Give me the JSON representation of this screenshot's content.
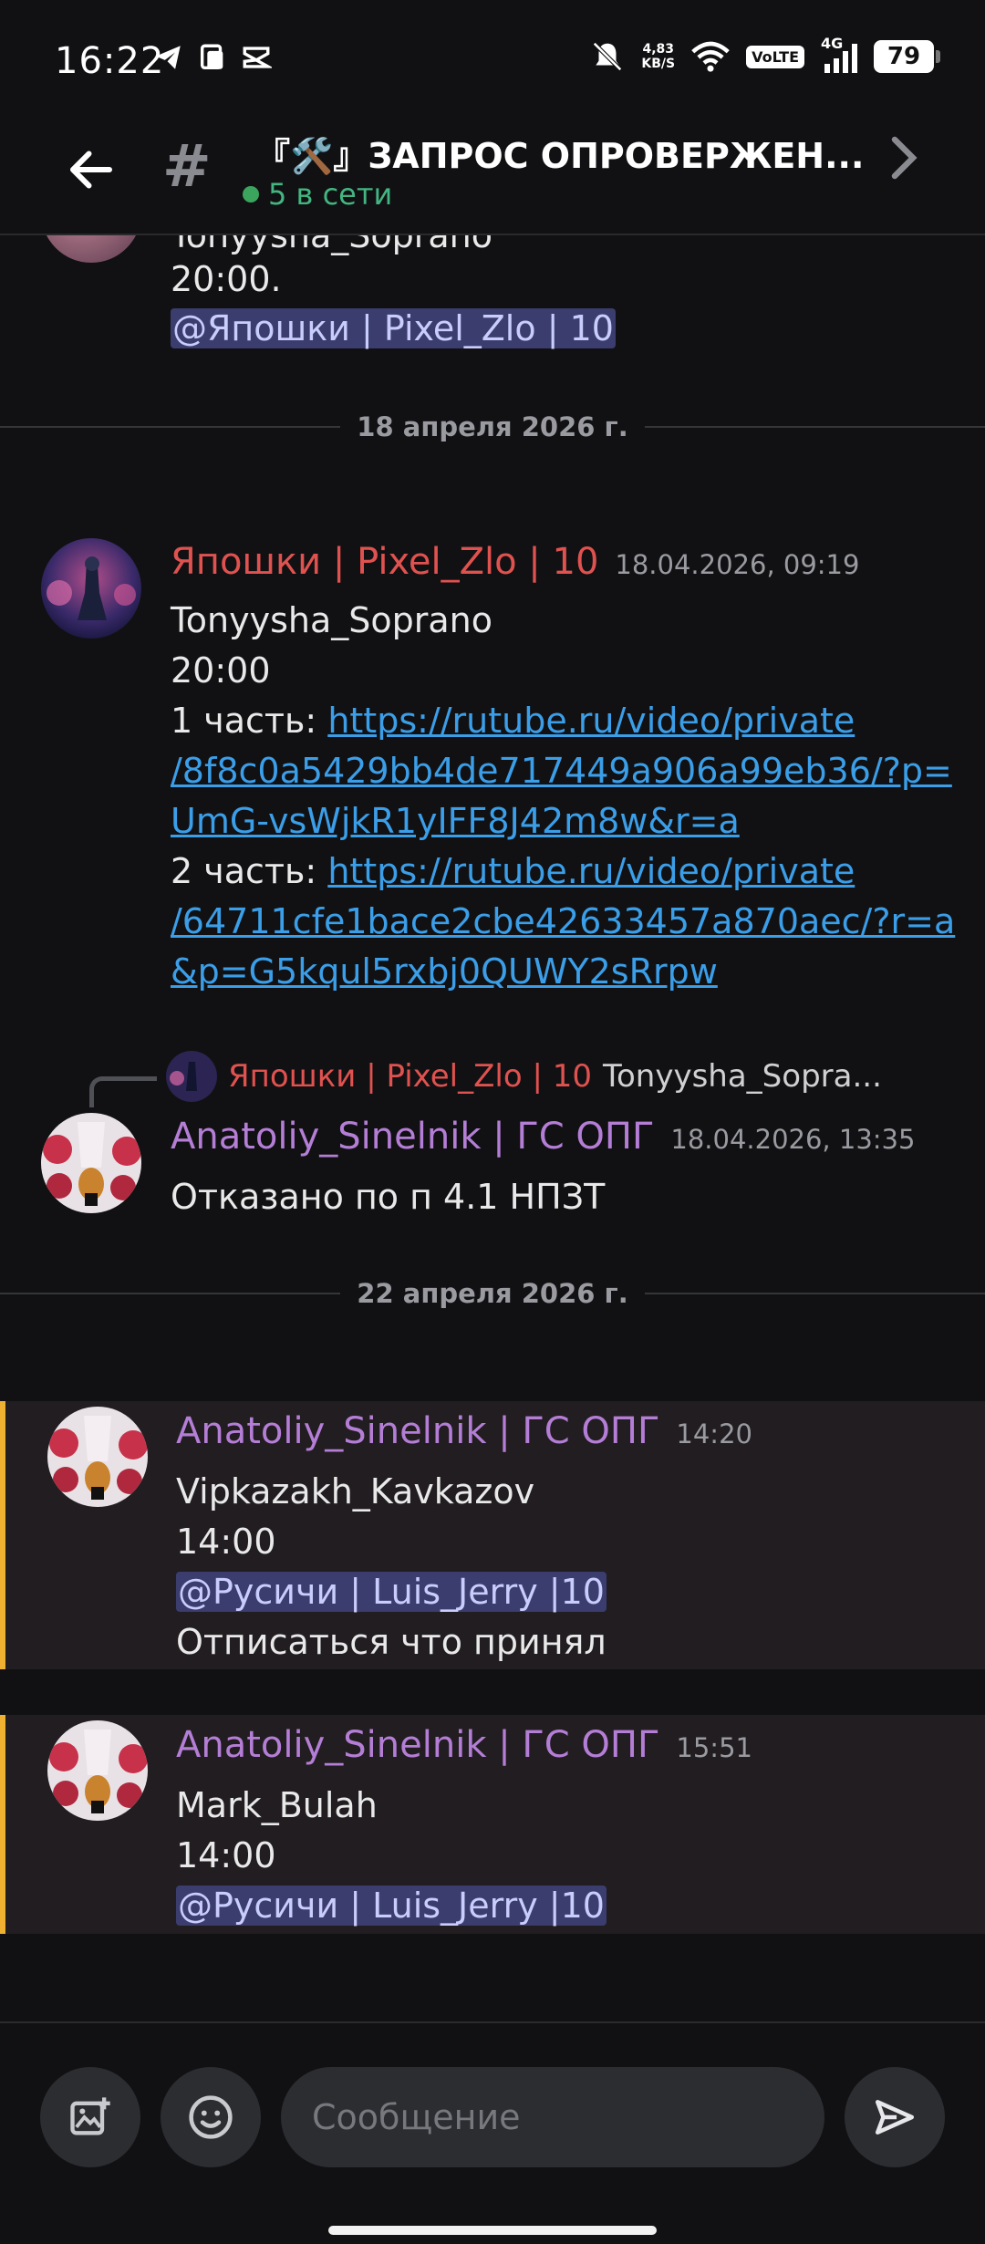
{
  "status_bar": {
    "time": "16:22",
    "net_speed_value": "4,83",
    "net_speed_unit": "KB/S",
    "volte": "VoLTE",
    "network": "4G",
    "battery": "79"
  },
  "header": {
    "channel_title": "『🛠️』ЗАПРОС ОПРОВЕРЖЕН...",
    "online": "5 в сети"
  },
  "messages": {
    "top_partial": {
      "author_line_cut": "Tonyysha_Soprano",
      "time_text": "20:00.",
      "mention": "@Япошки | Pixel_Zlo | 10"
    },
    "sep1": "18 апреля 2026 г.",
    "m1": {
      "author": "Япошки | Pixel_Zlo | 10",
      "timestamp": "18.04.2026, 09:19",
      "line1": "Tonyysha_Soprano",
      "line2": "20:00",
      "part1_label": "1 часть: ",
      "part1_link_a": "https://rutube.ru/video/private",
      "part1_link_b": "/8f8c0a5429bb4de717449a906a99eb36/?p=",
      "part1_link_c": "UmG-vsWjkR1yIFF8J42m8w&r=a",
      "part2_label": "2 часть: ",
      "part2_link_a": "https://rutube.ru/video/private",
      "part2_link_b": "/64711cfe1bace2cbe42633457a870aec/?r=a",
      "part2_link_c": "&p=G5kqul5rxbj0QUWY2sRrpw"
    },
    "m2": {
      "reply_author": "Япошки | Pixel_Zlo | 10",
      "reply_text": "Tonyysha_Sopra...",
      "author": "Anatoliy_Sinelnik | ГС ОПГ",
      "timestamp": "18.04.2026, 13:35",
      "line1": "Отказано по п 4.1 НПЗТ"
    },
    "sep2": "22 апреля 2026 г.",
    "m3": {
      "author": "Anatoliy_Sinelnik | ГС ОПГ",
      "timestamp": "14:20",
      "line1": "Vipkazakh_Kavkazov",
      "line2": "14:00",
      "mention": "@Русичи | Luis_Jerry |10",
      "line4": "Отписаться что принял"
    },
    "m4": {
      "author": "Anatoliy_Sinelnik | ГС ОПГ",
      "timestamp": "15:51",
      "line1": "Mark_Bulah",
      "line2": "14:00",
      "mention": "@Русичи | Luis_Jerry |10"
    }
  },
  "composer": {
    "placeholder": "Сообщение"
  },
  "colors": {
    "background": "#111113",
    "author_red": "#e0524f",
    "author_purple": "#b57ed6",
    "link": "#3b9ee8",
    "mention_bg": "#3a3d6e",
    "highlight_border": "#f0b132",
    "online_green": "#3ba55d"
  },
  "icons": [
    "telegram-icon",
    "screen-icon",
    "capcut-icon",
    "mute-bell-icon",
    "wifi-icon",
    "signal-icon",
    "battery-icon",
    "back-arrow-icon",
    "hash-icon",
    "chevron-right-icon",
    "add-image-icon",
    "emoji-icon",
    "send-icon"
  ]
}
